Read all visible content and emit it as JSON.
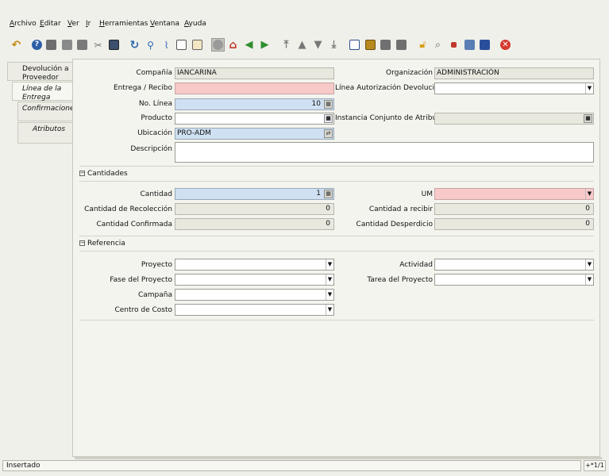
{
  "menu": [
    {
      "label": "Archivo",
      "u": "A",
      "rest": "rchivo"
    },
    {
      "label": "Editar",
      "u": "E",
      "rest": "ditar"
    },
    {
      "label": "Ver",
      "u": "V",
      "rest": "er"
    },
    {
      "label": "Ir",
      "u": "I",
      "rest": "r"
    },
    {
      "label": "Herramientas",
      "u": "H",
      "rest": "erramientas"
    },
    {
      "label": "Ventana",
      "u": "V",
      "rest": "entana"
    },
    {
      "label": "Ayuda",
      "u": "A",
      "rest": "yuda"
    }
  ],
  "tabs": [
    {
      "label": "Devolución a Proveedor"
    },
    {
      "label": "Línea de la Entrega"
    },
    {
      "label": "Confirmaciones"
    },
    {
      "label": "Atributos"
    }
  ],
  "form": {
    "compania_label": "Compañía",
    "compania_value": "IANCARINA",
    "organizacion_label": "Organización",
    "organizacion_value": "ADMINISTRACIÓN",
    "entrega_label": "Entrega / Recibo",
    "entrega_value": "",
    "linea_aut_label": "Línea Autorización Devolución",
    "linea_aut_value": "",
    "no_linea_label": "No. Línea",
    "no_linea_value": "10",
    "producto_label": "Producto",
    "producto_value": "",
    "instancia_label": "Instancia Conjunto de Atributos",
    "instancia_value": "",
    "ubicacion_label": "Ubicación",
    "ubicacion_value": "PRO-ADM",
    "descripcion_label": "Descripción",
    "descripcion_value": ""
  },
  "cantidades": {
    "title": "Cantidades",
    "cantidad_label": "Cantidad",
    "cantidad_value": "1",
    "um_label": "UM",
    "um_value": "",
    "recoleccion_label": "Cantidad de Recolección",
    "recoleccion_value": "0",
    "a_recibir_label": "Cantidad a recibir",
    "a_recibir_value": "0",
    "confirmada_label": "Cantidad Confirmada",
    "confirmada_value": "0",
    "desperdicio_label": "Cantidad Desperdicio",
    "desperdicio_value": "0"
  },
  "referencia": {
    "title": "Referencia",
    "proyecto_label": "Proyecto",
    "actividad_label": "Actividad",
    "fase_label": "Fase del Proyecto",
    "tarea_label": "Tarea del Proyecto",
    "campana_label": "Campaña",
    "centro_label": "Centro de Costo"
  },
  "status": {
    "text": "Insertado",
    "pager": "+*1/1"
  },
  "colors": {
    "required": "#f8c9c9",
    "selected": "#cfe0f2",
    "readonly": "#e8e8df"
  },
  "toolbar_icons": [
    "undo-icon",
    "help-icon",
    "new-icon",
    "copy-icon",
    "delete-icon",
    "delete-selection-icon",
    "save-icon",
    "refresh-icon",
    "find-icon",
    "attachment-icon",
    "chat-icon",
    "history-icon",
    "home-icon",
    "parent-icon",
    "previous-tab-icon",
    "next-tab-icon",
    "first-record-icon",
    "previous-record-icon",
    "next-record-icon",
    "last-record-icon",
    "report-icon",
    "archive-icon",
    "print-preview-icon",
    "print-icon",
    "lock-icon",
    "zoom-across-icon",
    "active-workflows-icon",
    "requests-icon",
    "product-info-icon",
    "exit-icon"
  ]
}
